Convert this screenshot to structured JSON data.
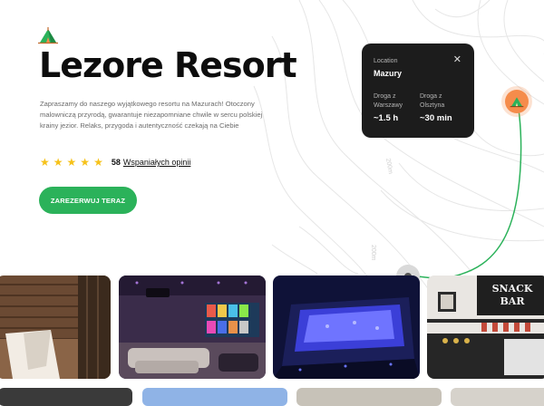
{
  "brand": {
    "logo_icon": "camp-tent-icon"
  },
  "hero": {
    "title": "Lezore Resort",
    "description": "Zapraszamy do naszego wyjątkowego resortu na Mazurach! Otoczony malowniczą przyrodą, gwarantuje niezapomniane chwile w sercu polskiej krainy jezior. Relaks, przygoda i autentyczność czekają na Ciebie",
    "rating": {
      "stars": 5,
      "count": "58",
      "link_label": "Wspaniałych opinii"
    },
    "cta_label": "ZAREZERWUJ TERAZ"
  },
  "location_card": {
    "label": "Location",
    "name": "Mazury",
    "close_icon": "close-icon",
    "distances": [
      {
        "label": "Droga z Warszawy",
        "value": "~1.5 h"
      },
      {
        "label": "Droga z Olsztyna",
        "value": "~30 min"
      }
    ]
  },
  "map": {
    "contour_labels": [
      "200m",
      "200m"
    ],
    "route_color": "#2bb25a",
    "pin_color": "#f58c4b"
  },
  "gallery": {
    "photos": [
      {
        "name": "sauna-photo"
      },
      {
        "name": "cinema-room-photo"
      },
      {
        "name": "jacuzzi-photo"
      },
      {
        "name": "snack-bar-photo",
        "sign": "SNACK BAR"
      }
    ]
  },
  "colors": {
    "accent": "#2bb25a",
    "star": "#f6c21a",
    "card_bg": "#1c1c1c",
    "pin": "#f58c4b"
  }
}
